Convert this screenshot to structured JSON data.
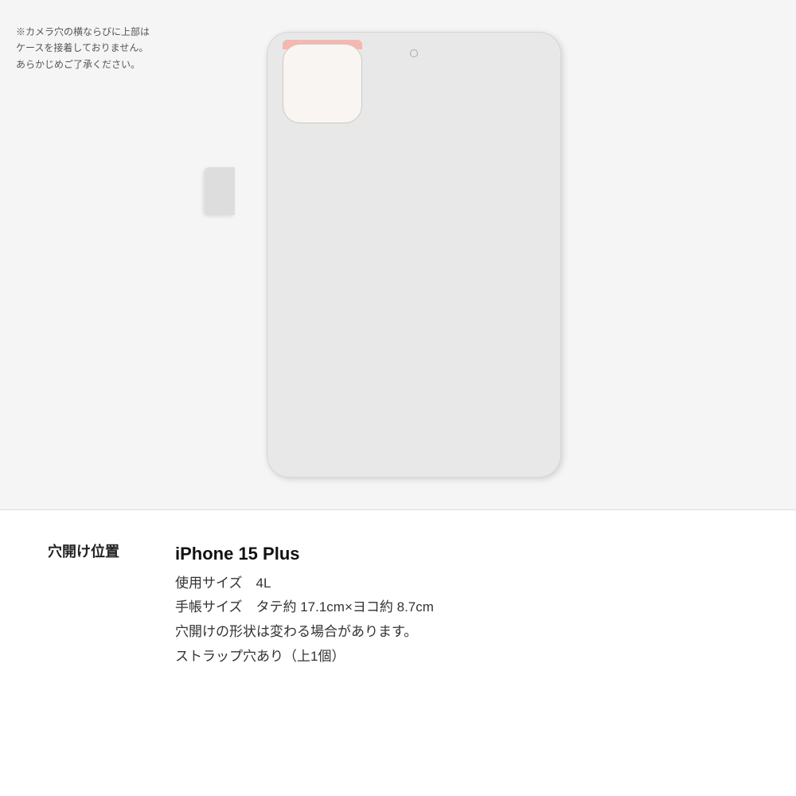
{
  "warning": {
    "text": "※カメラ穴の横ならびに上部は\nケースを接着しておりません。\nあらかじめご了承ください。"
  },
  "info": {
    "label": "穴開け位置",
    "model_name": "iPhone 15 Plus",
    "size_label": "使用サイズ　4L",
    "dimensions_label": "手帳サイズ　タテ約 17.1cm×ヨコ約 8.7cm",
    "hole_shape_label": "穴開けの形状は変わる場合があります。",
    "strap_label": "ストラップ穴あり（上1個）"
  },
  "colors": {
    "background": "#f5f5f5",
    "case_body": "#e8e8e8",
    "camera_accent": "#f4b8b0",
    "text_dark": "#111111",
    "text_mid": "#333333",
    "text_light": "#555555"
  }
}
